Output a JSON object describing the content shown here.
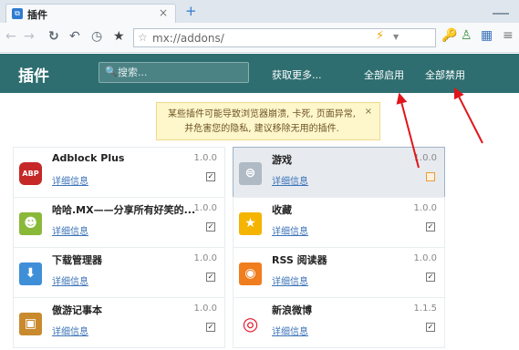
{
  "tab": {
    "title": "插件",
    "close": "×",
    "new": "+"
  },
  "nav": {
    "back": "←",
    "forward": "→",
    "reload": "↻",
    "undo": "↶",
    "history": "◷",
    "favorite": "★",
    "url": "mx://addons/",
    "url_star": "☆",
    "bolt": "⚡",
    "drop": "▼",
    "tools": [
      "🔑",
      "♙",
      "▦",
      "≡"
    ]
  },
  "header": {
    "title": "插件",
    "search_icon": "🔍",
    "search_placeholder": "搜索...",
    "get_more": "获取更多...",
    "enable_all": "全部启用",
    "disable_all": "全部禁用"
  },
  "warning": {
    "text": "某些插件可能导致浏览器崩溃, 卡死, 页面异常, 并危害您的隐私, 建议移除无用的插件.",
    "close": "×"
  },
  "plugins": [
    {
      "name": "Adblock Plus",
      "details": "详细信息",
      "version": "1.0.0",
      "enabled": true,
      "icon": "abp-icon",
      "icon_text": "ABP",
      "color": "#c62828"
    },
    {
      "name": "游戏",
      "details": "详细信息",
      "version": "1.0.0",
      "enabled": false,
      "icon": "gamepad-icon",
      "icon_text": "⊜",
      "color": "#b0bac4",
      "selected": true
    },
    {
      "name": "哈哈.MX——分享所有好笑的...",
      "details": "详细信息",
      "version": "1.0.0",
      "enabled": true,
      "icon": "smiley-icon",
      "icon_text": "☻",
      "color": "#8ab93a"
    },
    {
      "name": "收藏",
      "details": "详细信息",
      "version": "1.0.0",
      "enabled": true,
      "icon": "star-icon",
      "icon_text": "★",
      "color": "#f4b400"
    },
    {
      "name": "下载管理器",
      "details": "详细信息",
      "version": "1.0.0",
      "enabled": true,
      "icon": "download-icon",
      "icon_text": "⬇",
      "color": "#3f8fd8"
    },
    {
      "name": "RSS 阅读器",
      "details": "详细信息",
      "version": "1.0.0",
      "enabled": true,
      "icon": "rss-icon",
      "icon_text": "◉",
      "color": "#f07d1e"
    },
    {
      "name": "傲游记事本",
      "details": "详细信息",
      "version": "1.0.0",
      "enabled": true,
      "icon": "notebook-icon",
      "icon_text": "▣",
      "color": "#c98a2e"
    },
    {
      "name": "新浪微博",
      "details": "详细信息",
      "version": "1.1.5",
      "enabled": true,
      "icon": "weibo-icon",
      "icon_text": "◎",
      "color": "#e6162d"
    }
  ],
  "check_mark": "✓",
  "colors": {
    "header": "#2e6e70",
    "link": "#3d73b8",
    "warn_bg": "#fff7cc",
    "annotation": "#e0161b"
  }
}
